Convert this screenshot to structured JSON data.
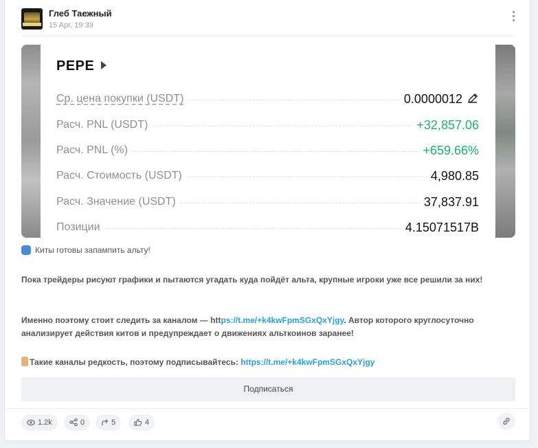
{
  "post": {
    "author": "Глеб Таежный",
    "time": "15 Apr, 19:39"
  },
  "screenshot": {
    "coin": "PEPE",
    "rows": [
      {
        "label": "Ср. цена покупки (USDT)",
        "value": "0.0000012",
        "color": "default",
        "editable": true
      },
      {
        "label": "Расч. PNL (USDT)",
        "value": "+32,857.06",
        "color": "#20b26c"
      },
      {
        "label": "Расч. PNL (%)",
        "value": "+659.66%",
        "color": "#20b26c"
      },
      {
        "label": "Расч. Стоимость (USDT)",
        "value": "4,980.85",
        "color": "default"
      },
      {
        "label": "Расч. Значение (USDT)",
        "value": "37,837.91",
        "color": "default"
      },
      {
        "label": "Позиции",
        "value": "4.15071517B",
        "color": "default"
      }
    ]
  },
  "text": {
    "intro": "Киты готовы запампить альту!",
    "p1": "Пока трейдеры рисуют графики и пытаются угадать куда пойдёт альта, крупные игроки уже все решили за них!",
    "p2_pre": "Именно поэтому стоит следить за каналом — htt",
    "p2_link": "ps://t.me/+k4kwFpmSGxQxYjgy",
    "p2_post": ". Автор которого круглосуточно анализирует действия китов и предупреждает о движениях альткоинов заранее!",
    "p3_pre": "Такие каналы редкость, поэтому подписывайтесь: ",
    "p3_link": "https://t.me/+k4kwFpmSGxQxYjgy"
  },
  "subscribe_label": "Подписаться",
  "stats": {
    "views": "1.2k",
    "shares": "0",
    "reposts": "5",
    "likes": "4"
  },
  "icons": {
    "views": "eye-icon",
    "shares": "share-icon",
    "reposts": "repost-arrow-icon",
    "likes": "thumbs-up-icon",
    "link": "link-icon",
    "menu": "more-vertical-icon",
    "edit": "pencil-icon"
  }
}
